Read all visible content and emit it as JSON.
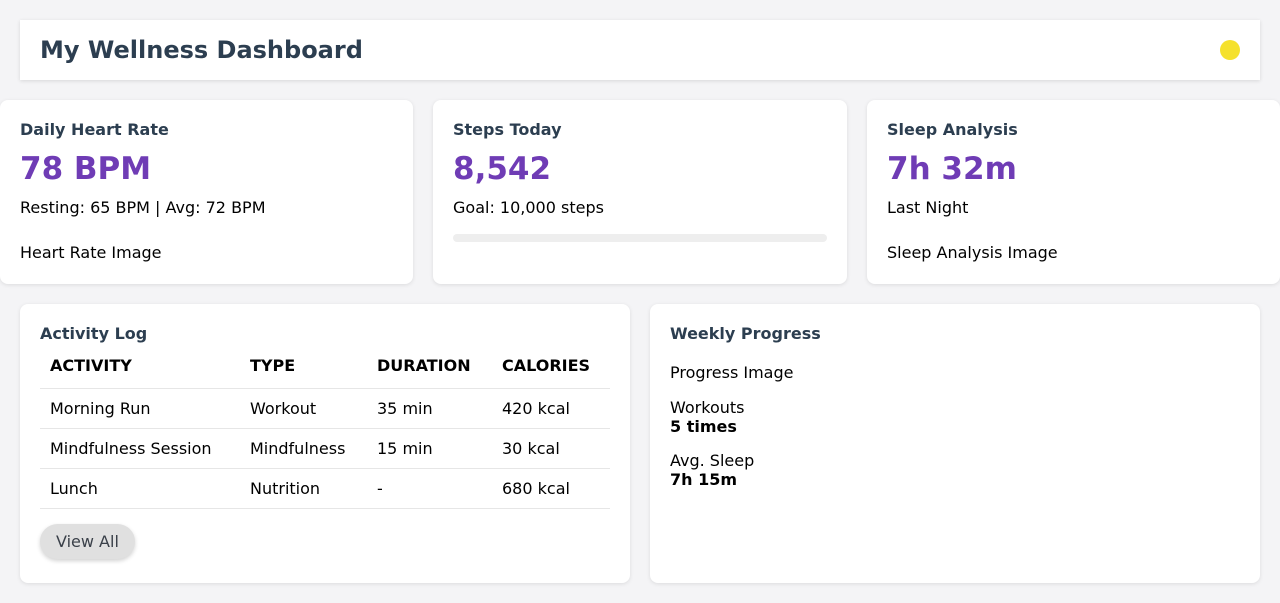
{
  "header": {
    "title": "My Wellness Dashboard",
    "status_color": "#f5e12c"
  },
  "accent_color": "#6f3cb5",
  "metrics": [
    {
      "title": "Daily Heart Rate",
      "value": "78 BPM",
      "sub": "Resting: 65 BPM | Avg: 72 BPM",
      "image_alt": "Heart Rate Image"
    },
    {
      "title": "Steps Today",
      "value": "8,542",
      "sub": "Goal: 10,000 steps",
      "progress": 0
    },
    {
      "title": "Sleep Analysis",
      "value": "7h 32m",
      "sub": "Last Night",
      "image_alt": "Sleep Analysis Image"
    }
  ],
  "activity_log": {
    "title": "Activity Log",
    "columns": [
      "ACTIVITY",
      "TYPE",
      "DURATION",
      "CALORIES"
    ],
    "rows": [
      [
        "Morning Run",
        "Workout",
        "35 min",
        "420 kcal"
      ],
      [
        "Mindfulness Session",
        "Mindfulness",
        "15 min",
        "30 kcal"
      ],
      [
        "Lunch",
        "Nutrition",
        "-",
        "680 kcal"
      ]
    ],
    "view_all_label": "View All"
  },
  "weekly_progress": {
    "title": "Weekly Progress",
    "image_alt": "Progress Image",
    "stats": [
      {
        "label": "Workouts",
        "value": "5 times"
      },
      {
        "label": "Avg. Sleep",
        "value": "7h 15m"
      }
    ]
  }
}
